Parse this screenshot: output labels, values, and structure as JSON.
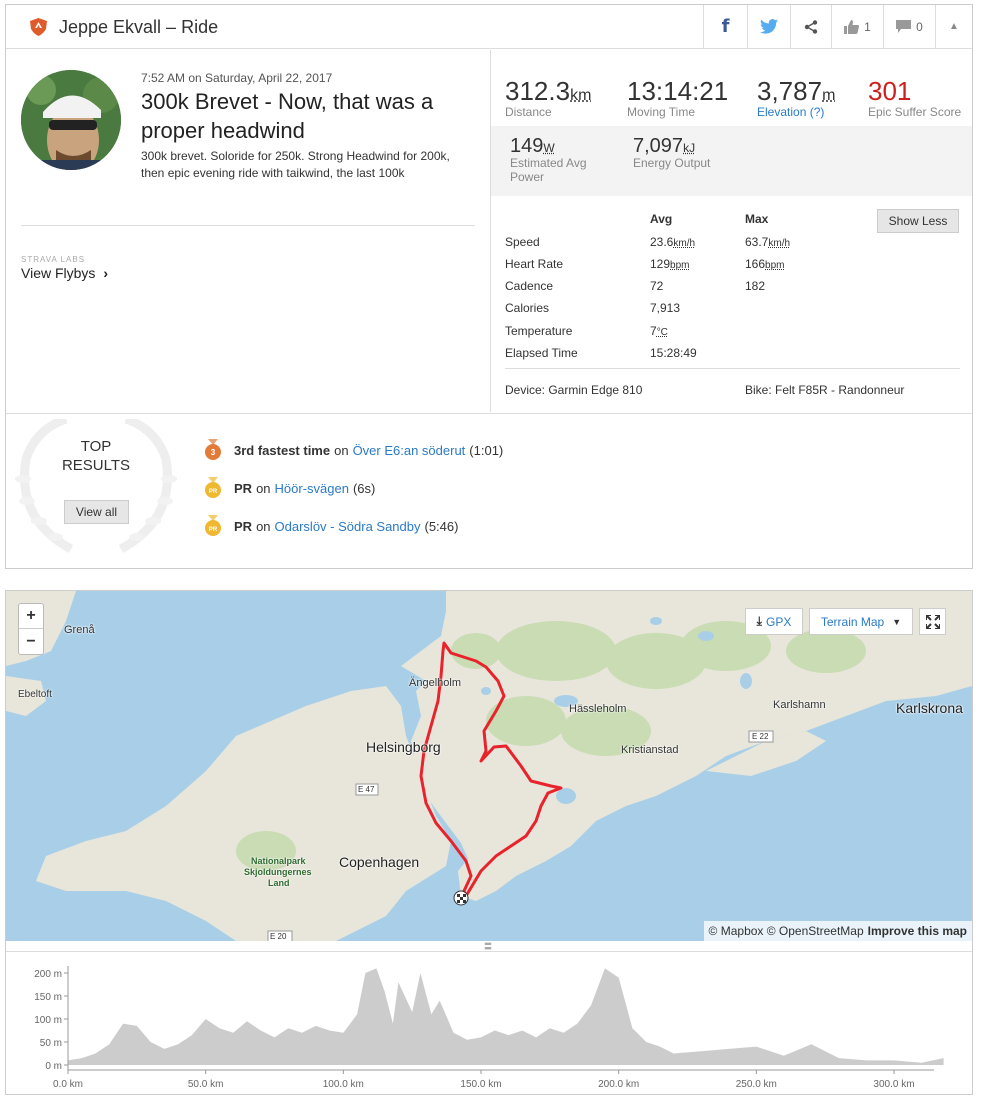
{
  "header": {
    "title": "Jeppe Ekvall – Ride",
    "facebook_icon": "f",
    "kudos_count": "1",
    "comment_count": "0"
  },
  "activity": {
    "datetime": "7:52 AM on Saturday, April 22, 2017",
    "title": "300k Brevet - Now, that was a proper headwind",
    "description": "300k brevet. Soloride for 250k. Strong Headwind for 200k, then epic evening ride with taikwind, the last 100k",
    "labs_label": "STRAVA LABS",
    "flyby_label": "View Flybys"
  },
  "stats": {
    "distance": {
      "value": "312.3",
      "unit": "km",
      "label": "Distance"
    },
    "moving_time": {
      "value": "13:14:21",
      "label": "Moving Time"
    },
    "elevation": {
      "value": "3,787",
      "unit": "m",
      "label": "Elevation (?)"
    },
    "suffer": {
      "value": "301",
      "label": "Epic Suffer Score"
    },
    "power": {
      "value": "149",
      "unit": "W",
      "label": "Estimated Avg Power"
    },
    "energy": {
      "value": "7,097",
      "unit": "kJ",
      "label": "Energy Output"
    }
  },
  "more_stats": {
    "avg_header": "Avg",
    "max_header": "Max",
    "show_less": "Show Less",
    "rows": [
      {
        "label": "Speed",
        "avg": "23.6",
        "avg_unit": "km/h",
        "max": "63.7",
        "max_unit": "km/h"
      },
      {
        "label": "Heart Rate",
        "avg": "129",
        "avg_unit": "bpm",
        "max": "166",
        "max_unit": "bpm"
      },
      {
        "label": "Cadence",
        "avg": "72",
        "avg_unit": "",
        "max": "182",
        "max_unit": ""
      },
      {
        "label": "Calories",
        "avg": "7,913",
        "avg_unit": "",
        "max": "",
        "max_unit": ""
      },
      {
        "label": "Temperature",
        "avg": "7",
        "avg_unit": "°C",
        "max": "",
        "max_unit": ""
      },
      {
        "label": "Elapsed Time",
        "avg": "15:28:49",
        "avg_unit": "",
        "max": "",
        "max_unit": ""
      }
    ],
    "device": "Device: Garmin Edge 810",
    "bike": "Bike: Felt F85R - Randonneur"
  },
  "results": {
    "title_line1": "TOP",
    "title_line2": "RESULTS",
    "view_all": "View all",
    "items": [
      {
        "medal": "3",
        "medal_color": "#e07b39",
        "bold": "3rd fastest time",
        "on": "on",
        "segment": "Över E6:an söderut",
        "time": "(1:01)"
      },
      {
        "medal": "PR",
        "medal_color": "#f0b731",
        "bold": "PR",
        "on": "on",
        "segment": "Höör-svägen",
        "time": "(6s)"
      },
      {
        "medal": "PR",
        "medal_color": "#f0b731",
        "bold": "PR",
        "on": "on",
        "segment": "Odarslöv - Södra Sandby",
        "time": "(5:46)"
      }
    ]
  },
  "map": {
    "zoom_in": "+",
    "zoom_out": "−",
    "gpx_label": "GPX",
    "terrain_label": "Terrain Map",
    "places": [
      "Grenå",
      "Ebeltoft",
      "Ängelholm",
      "Helsingborg",
      "Hässleholm",
      "Kristianstad",
      "Karlshamn",
      "Karlskrona",
      "Copenhagen",
      "Nationalpark",
      "Skjoldungernes",
      "Land"
    ],
    "roads": [
      "E 47",
      "E 22",
      "E 20"
    ],
    "attribution_prefix": "© Mapbox © OpenStreetMap",
    "attribution_link": "Improve this map",
    "route_color": "#e8232b"
  },
  "chart_data": {
    "type": "area",
    "title": "",
    "xlabel": "",
    "ylabel": "",
    "x_ticks": [
      "0.0 km",
      "50.0 km",
      "100.0 km",
      "150.0 km",
      "200.0 km",
      "250.0 km",
      "300.0 km"
    ],
    "y_ticks": [
      "0 m",
      "50 m",
      "100 m",
      "150 m",
      "200 m"
    ],
    "xlim": [
      0,
      320
    ],
    "ylim": [
      0,
      220
    ],
    "series": [
      {
        "x": [
          0,
          5,
          10,
          15,
          20,
          25,
          30,
          35,
          40,
          45,
          50,
          55,
          60,
          65,
          70,
          75,
          80,
          85,
          90,
          95,
          100,
          105,
          108,
          112,
          115,
          118,
          120,
          125,
          128,
          132,
          135,
          140,
          145,
          150,
          155,
          160,
          165,
          170,
          175,
          180,
          185,
          190,
          195,
          200,
          205,
          210,
          215,
          220,
          230,
          240,
          250,
          260,
          270,
          280,
          290,
          300,
          310,
          318
        ],
        "values": [
          10,
          15,
          25,
          45,
          90,
          85,
          50,
          35,
          45,
          65,
          100,
          80,
          70,
          95,
          75,
          60,
          80,
          70,
          85,
          75,
          70,
          110,
          200,
          210,
          160,
          90,
          180,
          115,
          200,
          110,
          140,
          70,
          55,
          60,
          75,
          65,
          75,
          60,
          80,
          70,
          90,
          130,
          210,
          190,
          80,
          50,
          40,
          25,
          30,
          35,
          40,
          20,
          45,
          15,
          10,
          10,
          5,
          15
        ]
      }
    ],
    "fill_color": "#cccccc"
  }
}
